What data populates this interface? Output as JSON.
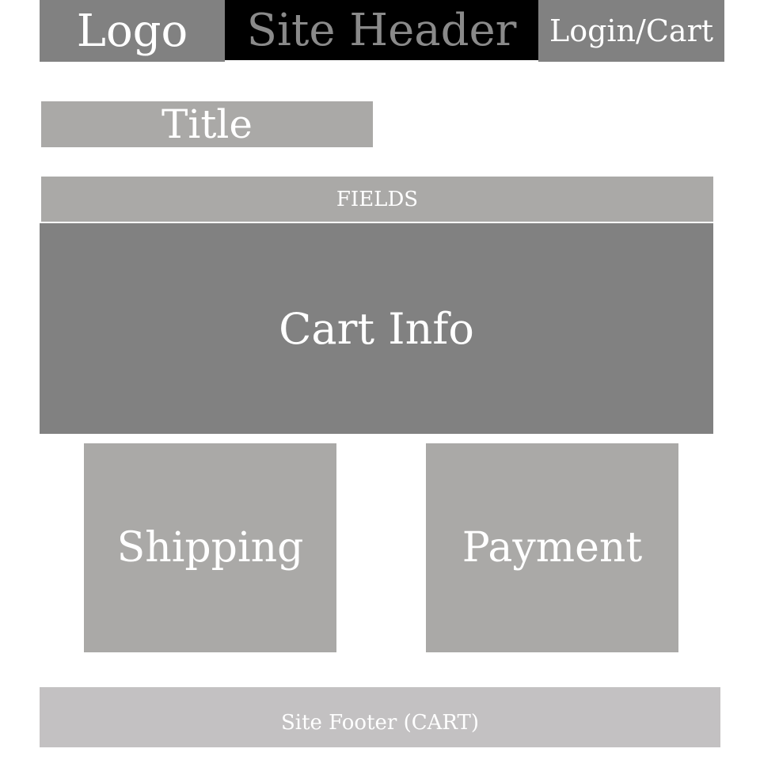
{
  "header": {
    "logo": "Logo",
    "site_header": "Site Header",
    "login_cart": "Login/Cart"
  },
  "main": {
    "title": "Title",
    "fields": "FIELDS",
    "cart_info": "Cart Info",
    "shipping": "Shipping",
    "payment": "Payment"
  },
  "footer": {
    "label": "Site Footer (CART)"
  },
  "colors": {
    "dark_gray": "#818181",
    "light_gray": "#aaa9a7",
    "footer_gray": "#c3c1c2",
    "black": "#000000",
    "header_text": "#8a8a8a",
    "white_text": "#ffffff"
  }
}
